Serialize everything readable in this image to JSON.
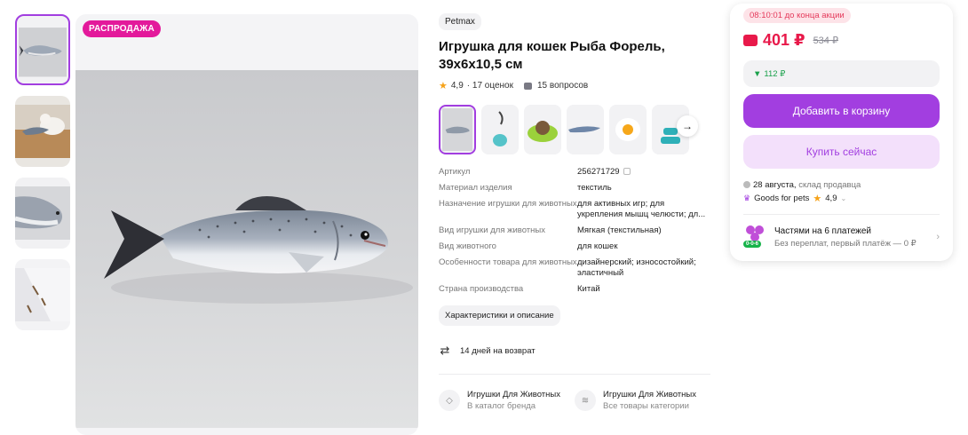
{
  "gallery": {
    "sale_badge": "РАСПРОДАЖА",
    "thumbnails": [
      "fish-toy-photo",
      "cat-with-fish-photo",
      "fish-closeup-photo",
      "fish-detail-photo"
    ]
  },
  "product": {
    "brand": "Petmax",
    "title": "Игрушка для кошек Рыба Форель, 39х6х10,5 см",
    "rating": "4,9",
    "reviews": "· 17 оценок",
    "questions": "15 вопросов"
  },
  "specs": [
    {
      "label": "Артикул",
      "value": "256271729"
    },
    {
      "label": "Материал изделия",
      "value": "текстиль"
    },
    {
      "label": "Назначение игрушки для животных",
      "value": "для активных игр; для укрепления мышц челюсти; дл..."
    },
    {
      "label": "Вид игрушки для животных",
      "value": "Мягкая (текстильная)"
    },
    {
      "label": "Вид животного",
      "value": "для кошек"
    },
    {
      "label": "Особенности товара для животных",
      "value": "дизайнерский; износостойкий; эластичный"
    },
    {
      "label": "Страна производства",
      "value": "Китай"
    }
  ],
  "characteristics_button": "Характеристики и описание",
  "return_policy": "14 дней на возврат",
  "links": [
    {
      "title": "Игрушки Для Животных",
      "subtitle": "В каталог бренда"
    },
    {
      "title": "Игрушки Для Животных",
      "subtitle": "Все товары категории"
    }
  ],
  "buy": {
    "timer": "08:10:01 до конца акции",
    "price": "401 ₽",
    "old_price": "534 ₽",
    "bonus": "112 ₽",
    "add_to_cart": "Добавить в корзину",
    "buy_now": "Купить сейчас",
    "delivery_date": "28 августа,",
    "delivery_source": "склад продавца",
    "seller_name": "Goods for pets",
    "seller_rating": "4,9",
    "installments_title": "Частями на 6 платежей",
    "installments_sub": "Без переплат, первый платёж — 0 ₽",
    "installments_badge": "0-0-6"
  },
  "colors": {
    "accent": "#a23ee0",
    "sale": "#e3199b",
    "price": "#e8194a",
    "bonus": "#1aa14b"
  }
}
